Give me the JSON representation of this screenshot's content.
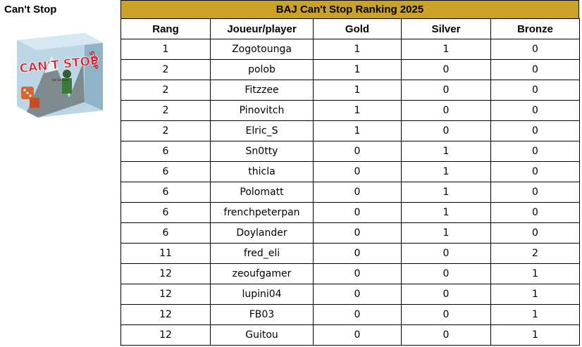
{
  "sheet": {
    "game_title": "Can't Stop",
    "table_title": "BAJ Can't Stop Ranking 2025",
    "box_art": {
      "logo_text": "CAN'T STOP",
      "author_text": "Sid Sackson"
    }
  },
  "columns": [
    "Rang",
    "Joueur/player",
    "Gold",
    "Silver",
    "Bronze"
  ],
  "rows": [
    [
      "1",
      "Zogotounga",
      "1",
      "1",
      "0"
    ],
    [
      "2",
      "polob",
      "1",
      "0",
      "0"
    ],
    [
      "2",
      "Fitzzee",
      "1",
      "0",
      "0"
    ],
    [
      "2",
      "Pinovitch",
      "1",
      "0",
      "0"
    ],
    [
      "2",
      "Elric_S",
      "1",
      "0",
      "0"
    ],
    [
      "6",
      "Sn0tty",
      "0",
      "1",
      "0"
    ],
    [
      "6",
      "thicla",
      "0",
      "1",
      "0"
    ],
    [
      "6",
      "Polomatt",
      "0",
      "1",
      "0"
    ],
    [
      "6",
      "frenchpeterpan",
      "0",
      "1",
      "0"
    ],
    [
      "6",
      "Doylander",
      "0",
      "1",
      "0"
    ],
    [
      "11",
      "fred_eli",
      "0",
      "0",
      "2"
    ],
    [
      "12",
      "zeoufgamer",
      "0",
      "0",
      "1"
    ],
    [
      "12",
      "lupini04",
      "0",
      "0",
      "1"
    ],
    [
      "12",
      "FB03",
      "0",
      "0",
      "1"
    ],
    [
      "12",
      "Guitou",
      "0",
      "0",
      "1"
    ]
  ],
  "colors": {
    "title_bar": "#c9a227",
    "grid": "#000000"
  }
}
